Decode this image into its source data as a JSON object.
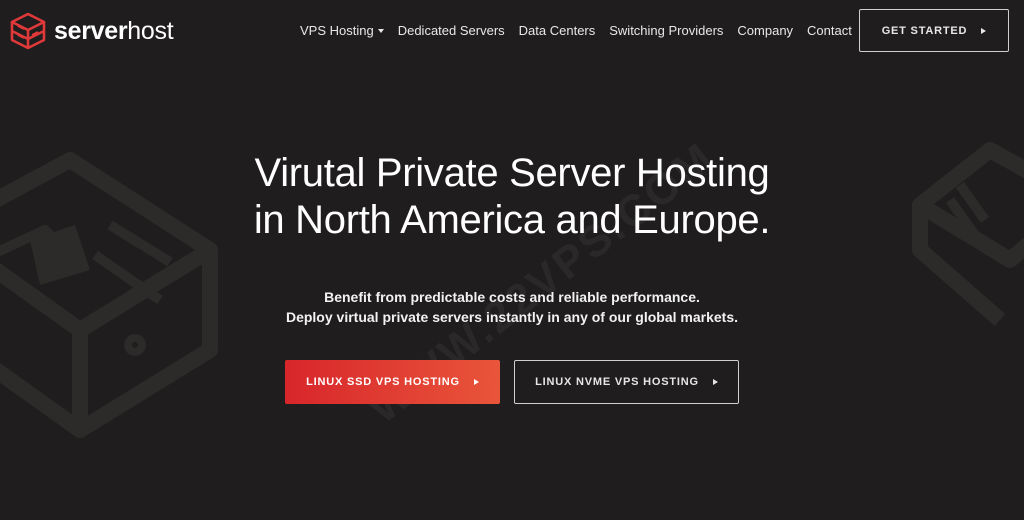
{
  "brand": {
    "name_bold": "server",
    "name_regular": "host",
    "logo_icon": "server-stack-icon",
    "accent_color": "#e0393a"
  },
  "nav": {
    "items": [
      {
        "label": "VPS Hosting",
        "has_dropdown": true
      },
      {
        "label": "Dedicated Servers"
      },
      {
        "label": "Data Centers"
      },
      {
        "label": "Switching Providers"
      },
      {
        "label": "Company"
      },
      {
        "label": "Contact"
      }
    ],
    "cta_label": "GET STARTED"
  },
  "hero": {
    "title_line1": "Virutal Private Server Hosting",
    "title_line2": "in North America and Europe.",
    "subtitle_line1": "Benefit from predictable costs and reliable performance.",
    "subtitle_line2": "Deploy virtual private servers instantly in any of our global markets.",
    "primary_button": "LINUX SSD VPS HOSTING",
    "secondary_button": "LINUX NVME VPS HOSTING"
  },
  "watermark": "WWW.22VPS.COM",
  "colors": {
    "background": "#1f1d1d",
    "primary_gradient_start": "#d8262b",
    "primary_gradient_end": "#e9553a"
  }
}
